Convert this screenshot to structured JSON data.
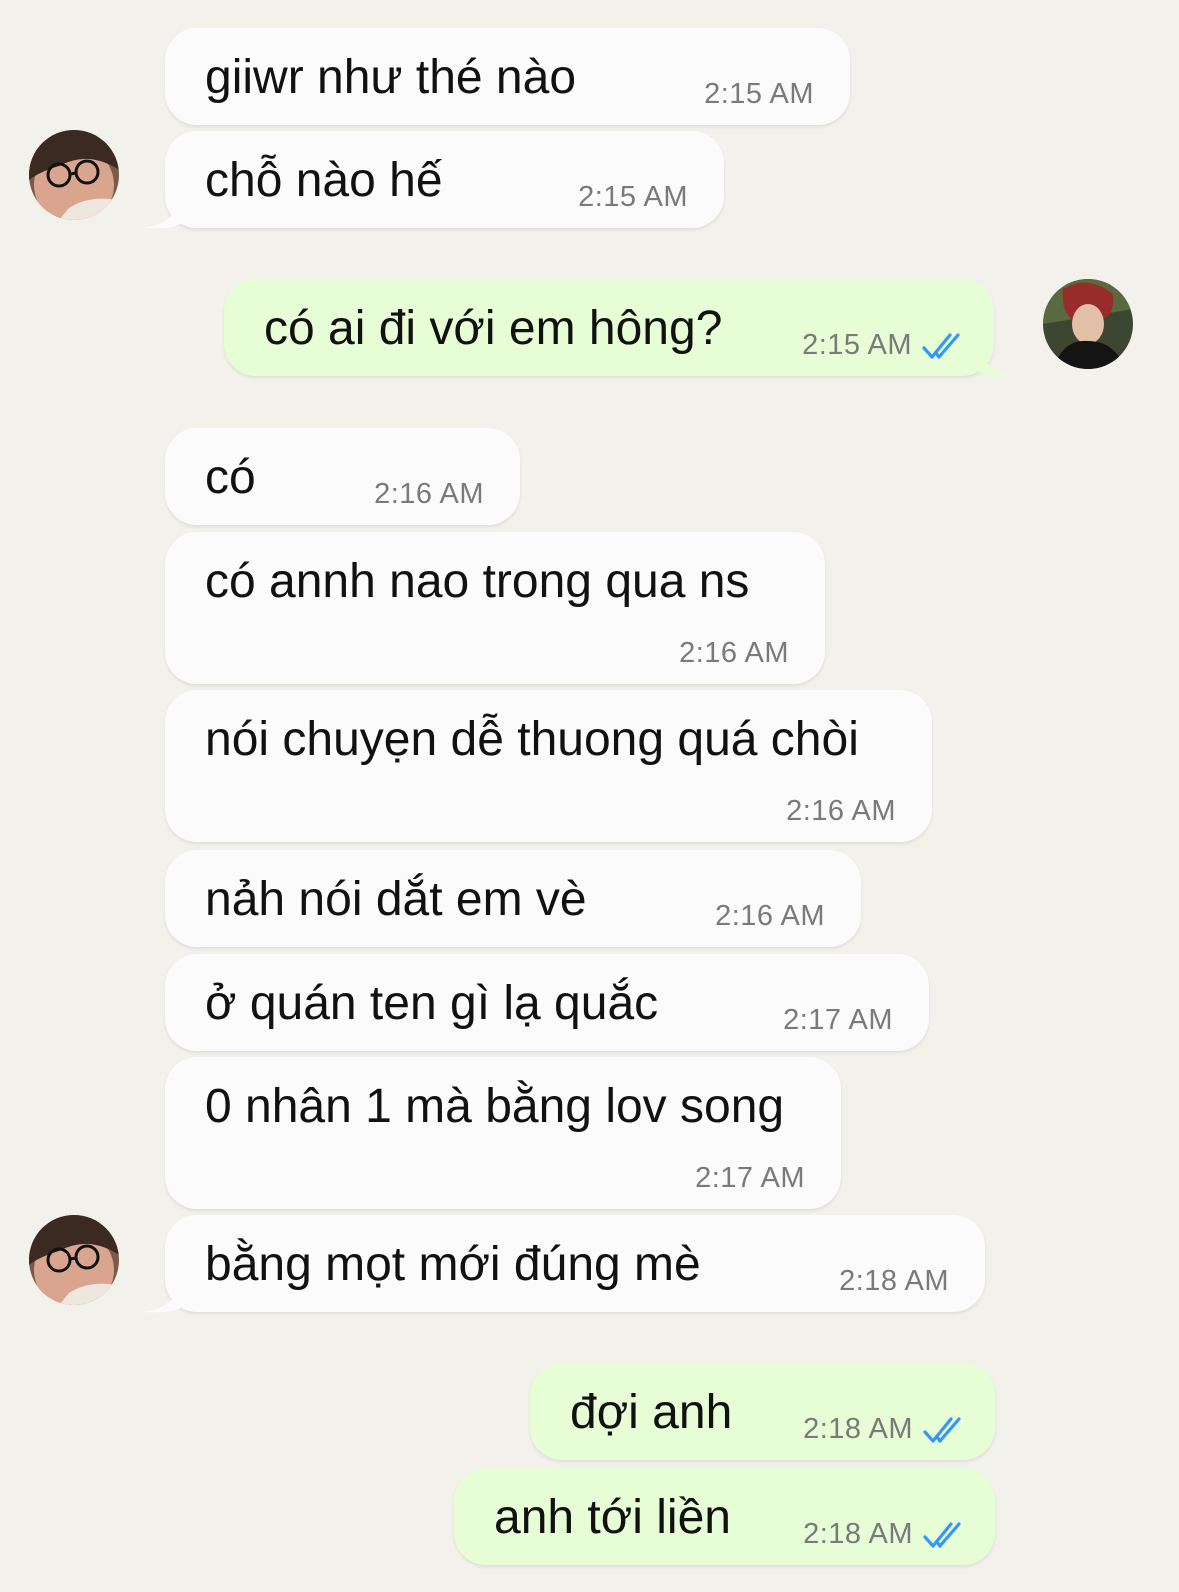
{
  "messages": [
    {
      "text": "giiwr như thé nào",
      "time": "2:15 AM"
    },
    {
      "text": "chỗ nào hế",
      "time": "2:15 AM"
    },
    {
      "text": "có ai đi với em hông?",
      "time": "2:15 AM"
    },
    {
      "text": "có",
      "time": "2:16 AM"
    },
    {
      "text": "có annh nao trong qua  ns",
      "time": "2:16 AM"
    },
    {
      "text": "nói chuyẹn dễ thuong quá chòi",
      "time": "2:16 AM"
    },
    {
      "text": "nảh nói dắt em vè",
      "time": "2:16 AM"
    },
    {
      "text": "ở quán ten gì lạ quắc",
      "time": "2:17 AM"
    },
    {
      "text": "0 nhân 1 mà bằng lov song",
      "time": "2:17 AM"
    },
    {
      "text": "bằng mọt mới đúng mè",
      "time": "2:18 AM"
    },
    {
      "text": "đợi anh",
      "time": "2:18 AM"
    },
    {
      "text": "anh tới liền",
      "time": "2:18 AM"
    }
  ],
  "colors": {
    "background": "#f3f1ec",
    "incoming_bubble": "#fbfbfb",
    "outgoing_bubble": "#e7fdd6",
    "read_check": "#3497f9"
  },
  "icons": [
    "contact-avatar",
    "user-avatar",
    "double-check-icon"
  ]
}
